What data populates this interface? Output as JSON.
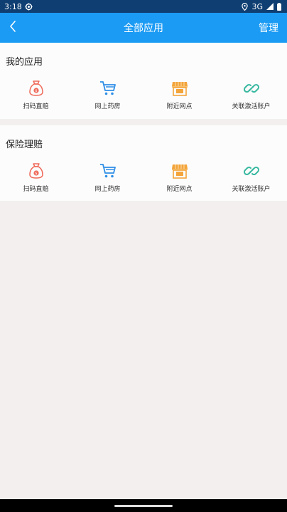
{
  "status": {
    "time": "3:18",
    "network": "3G"
  },
  "header": {
    "title": "全部应用",
    "manage": "管理"
  },
  "sections": [
    {
      "title": "我的应用",
      "items": [
        {
          "label": "扫码直赔",
          "icon": "money-bag-icon"
        },
        {
          "label": "网上药房",
          "icon": "shopping-cart-icon"
        },
        {
          "label": "附近网点",
          "icon": "store-icon"
        },
        {
          "label": "关联激活账户",
          "icon": "link-icon"
        }
      ]
    },
    {
      "title": "保险理赔",
      "items": [
        {
          "label": "扫码直赔",
          "icon": "money-bag-icon"
        },
        {
          "label": "网上药房",
          "icon": "shopping-cart-icon"
        },
        {
          "label": "附近网点",
          "icon": "store-icon"
        },
        {
          "label": "关联激活账户",
          "icon": "link-icon"
        }
      ]
    }
  ],
  "colors": {
    "statusbar": "#0f3e72",
    "appbar": "#1b9bf4",
    "money_bag": "#ef6a5a",
    "cart": "#2f8fe6",
    "store": "#f3a43b",
    "link": "#38b9a0"
  }
}
